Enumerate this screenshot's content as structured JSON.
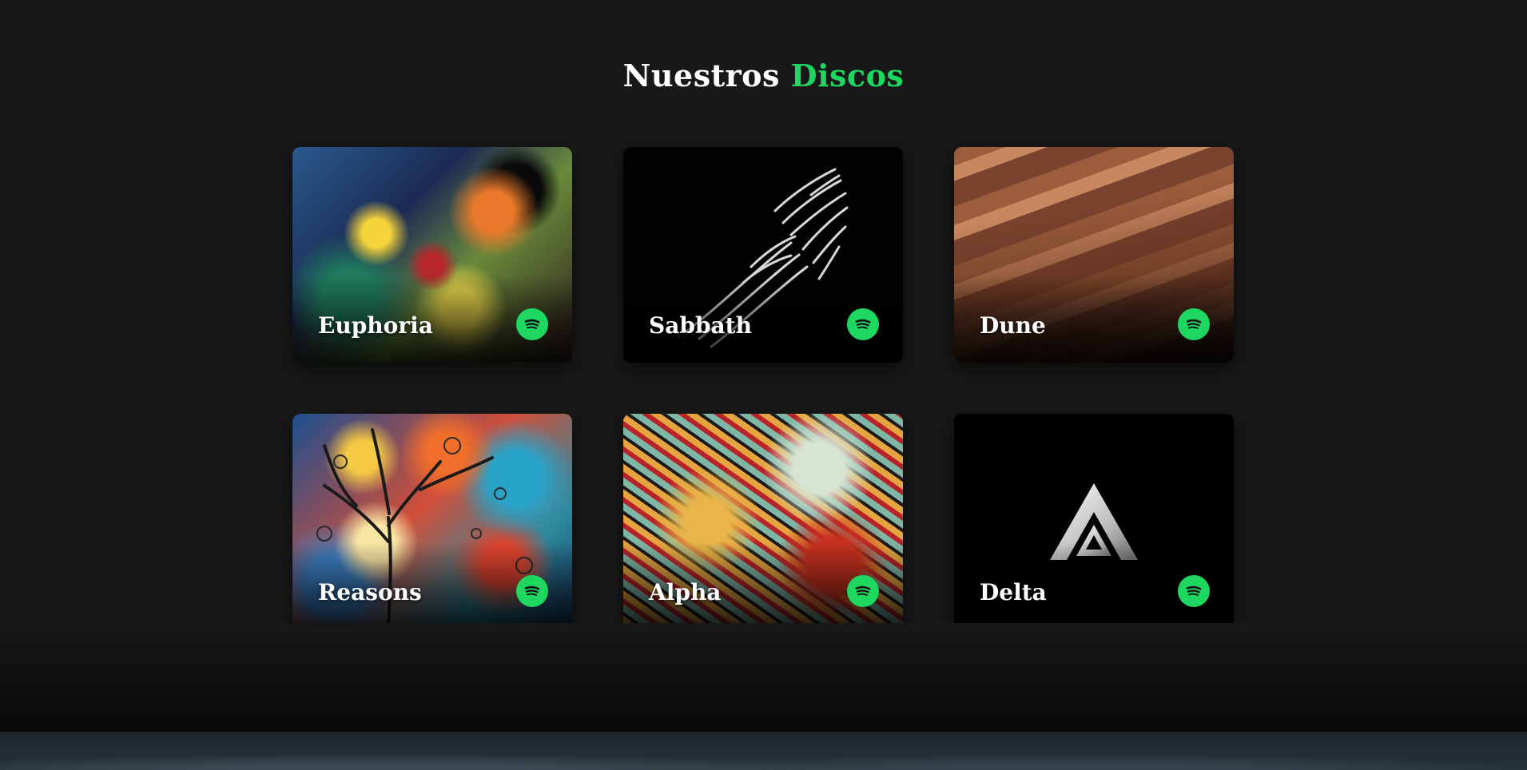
{
  "section": {
    "title_main": "Nuestros",
    "title_accent": "Discos"
  },
  "colors": {
    "accent": "#1ed760",
    "background": "#181818",
    "text": "#ffffff"
  },
  "albums": [
    {
      "title": "Euphoria",
      "icon": "spotify-icon"
    },
    {
      "title": "Sabbath",
      "icon": "spotify-icon"
    },
    {
      "title": "Dune",
      "icon": "spotify-icon"
    },
    {
      "title": "Reasons",
      "icon": "spotify-icon"
    },
    {
      "title": "Alpha",
      "icon": "spotify-icon"
    },
    {
      "title": "Delta",
      "icon": "spotify-icon"
    }
  ]
}
